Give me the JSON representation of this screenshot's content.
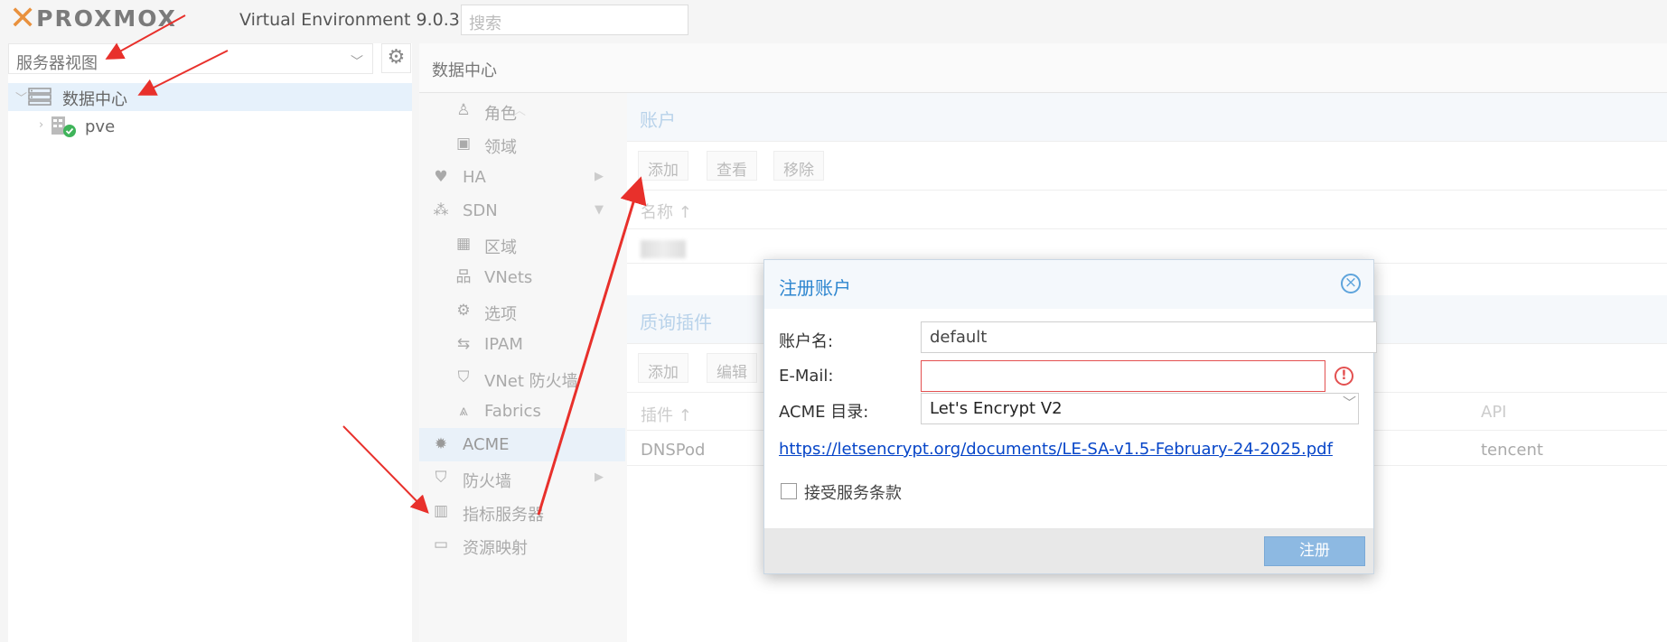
{
  "app": {
    "logo_text": "PROXMOX",
    "version": "Virtual Environment 9.0.3",
    "search_placeholder": "搜索"
  },
  "left": {
    "view_select": "服务器视图",
    "tree": [
      {
        "label": "数据中心"
      },
      {
        "label": "pve"
      }
    ]
  },
  "main": {
    "breadcrumb": "数据中心",
    "nav": [
      {
        "label": "角色",
        "icon": "person-icon"
      },
      {
        "label": "领域",
        "icon": "id-card-icon"
      },
      {
        "label": "HA",
        "icon": "heartbeat-icon"
      },
      {
        "label": "SDN",
        "icon": "sdn-icon"
      },
      {
        "label": "区域",
        "icon": "grid-icon"
      },
      {
        "label": "VNets",
        "icon": "network-icon"
      },
      {
        "label": "选项",
        "icon": "gear-icon"
      },
      {
        "label": "IPAM",
        "icon": "signpost-icon"
      },
      {
        "label": "VNet 防火墙",
        "icon": "shield-icon"
      },
      {
        "label": "Fabrics",
        "icon": "fabric-icon"
      },
      {
        "label": "ACME",
        "icon": "certificate-icon"
      },
      {
        "label": "防火墙",
        "icon": "shield-icon"
      },
      {
        "label": "指标服务器",
        "icon": "chart-icon"
      },
      {
        "label": "资源映射",
        "icon": "folder-icon"
      }
    ],
    "accounts": {
      "title": "账户",
      "buttons": {
        "add": "添加",
        "view": "查看",
        "remove": "移除"
      },
      "col_name": "名称 ↑"
    },
    "plugins": {
      "title": "质询插件",
      "buttons": {
        "add": "添加",
        "edit": "编辑"
      },
      "col_plugin": "插件 ↑",
      "col_api": "API",
      "rows": [
        {
          "plugin": "DNSPod",
          "api": "tencent"
        }
      ]
    }
  },
  "dialog": {
    "title": "注册账户",
    "account_name_label": "账户名:",
    "account_name_value": "default",
    "email_label": "E-Mail:",
    "email_value": "",
    "acme_dir_label": "ACME 目录:",
    "acme_dir_value": "Let's Encrypt V2",
    "tos_url": "https://letsencrypt.org/documents/LE-SA-v1.5-February-24-2025.pdf",
    "tos_accept_label": "接受服务条款",
    "tos_accepted": false,
    "register_label": "注册"
  }
}
